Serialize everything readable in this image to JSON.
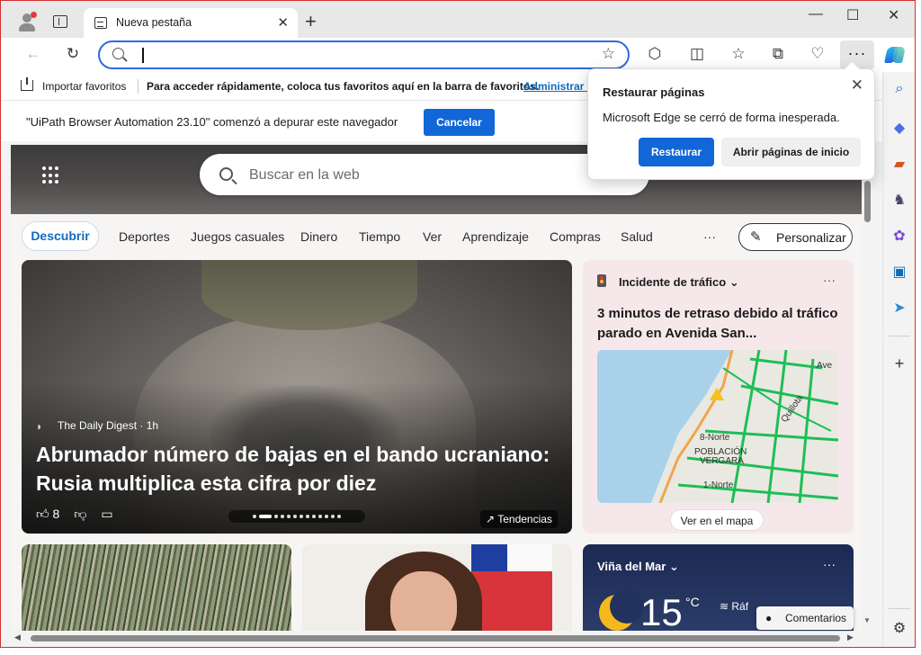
{
  "tab": {
    "title": "Nueva pestaña"
  },
  "favorites": {
    "import_label": "Importar favoritos",
    "message": "Para acceder rápidamente, coloca tus favoritos aquí en la barra de favoritos.",
    "manage_link": "Administrar fa"
  },
  "infobar": {
    "text": "\"UiPath Browser Automation 23.10\" comenzó a depurar este navegador",
    "cancel_label": "Cancelar"
  },
  "popup": {
    "title": "Restaurar páginas",
    "body": "Microsoft Edge se cerró de forma inesperada.",
    "restore_label": "Restaurar",
    "open_start_label": "Abrir páginas de inicio"
  },
  "search": {
    "placeholder": "Buscar en la web"
  },
  "nav": {
    "active": "Descubrir",
    "items": [
      "Deportes",
      "Juegos casuales",
      "Dinero",
      "Tiempo",
      "Ver",
      "Aprendizaje",
      "Compras",
      "Salud"
    ],
    "more": "···",
    "personalize": "Personalizar"
  },
  "main_story": {
    "source": "The Daily Digest · 1h",
    "headline": "Abrumador número de bajas en el bando ucraniano: Rusia multiplica esta cifra por diez",
    "likes": "8",
    "trending": "Tendencias"
  },
  "traffic": {
    "header": "Incidente de tráfico",
    "title": "3 minutos de retraso debido al tráfico parado en Avenida San...",
    "map_link": "Ver en el mapa",
    "map_labels": [
      "POBLACIÓN",
      "VERGARA",
      "8-Norte",
      "1-Norte",
      "Quillota",
      "Ave"
    ]
  },
  "weather": {
    "location": "Viña del Mar",
    "temp": "15",
    "unit": "°C",
    "wind": "Ráf"
  },
  "comments": {
    "label": "Comentarios"
  },
  "icons": {
    "addr_star": "☆",
    "more": "···",
    "more_dots": "···",
    "close": "✕",
    "chevron": "⌄",
    "menu_dots": "···",
    "new_tab": "+",
    "min": "—",
    "max": "☐",
    "win_close": "✕",
    "back": "←",
    "reload": "↻",
    "settings": "⚙"
  }
}
